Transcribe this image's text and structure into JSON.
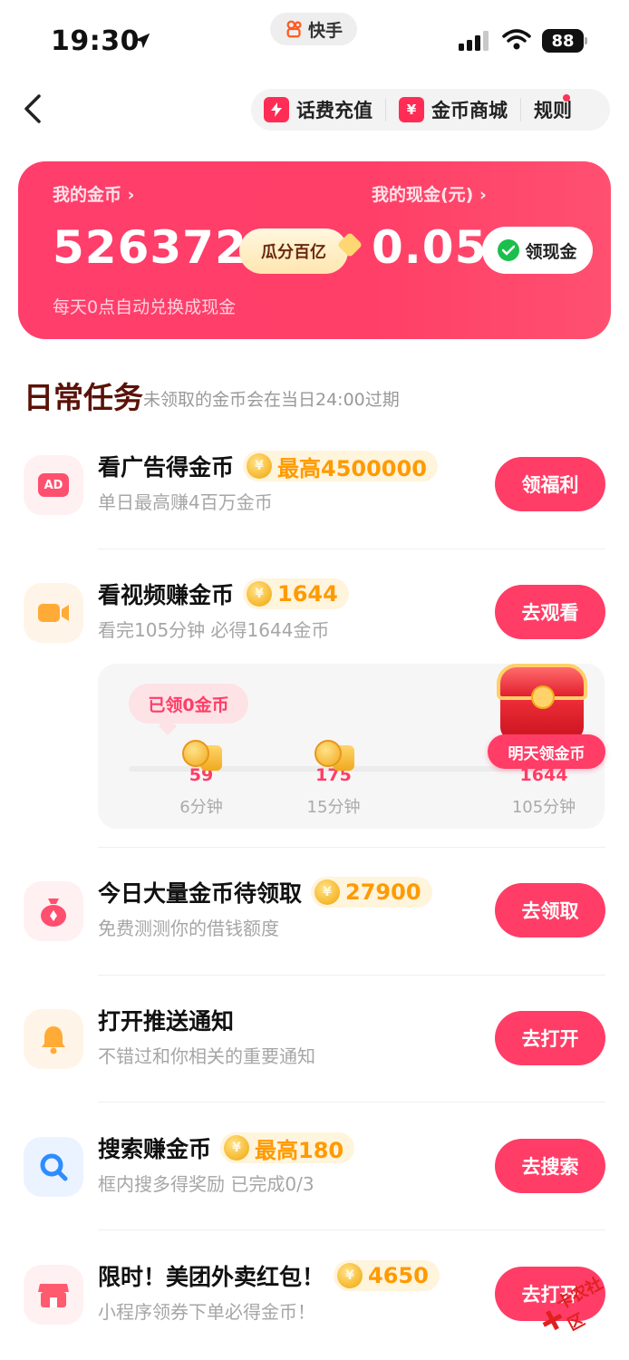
{
  "status_bar": {
    "time": "19:30",
    "app_pill": "快手",
    "battery": "88"
  },
  "top_nav": {
    "recharge_label": "话费充值",
    "mall_label": "金币商城",
    "rules_label": "规则"
  },
  "header_card": {
    "coins_label": "我的金币 ›",
    "coins_value": "526372",
    "share_badge": "瓜分百亿",
    "cash_label": "我的现金(元) ›",
    "cash_value": "0.05",
    "get_cash_button": "领现金",
    "note": "每天0点自动兑换成现金"
  },
  "daily_tasks": {
    "title": "日常任务",
    "subtitle": "未领取的金币会在当日24:00过期",
    "items": [
      {
        "title": "看广告得金币",
        "reward": "最高4500000",
        "desc": "单日最高赚4百万金币",
        "button": "领福利",
        "icon": "ad-icon"
      },
      {
        "title": "看视频赚金币",
        "reward": "1644",
        "desc": "看完105分钟 必得1644金币",
        "button": "去观看",
        "icon": "video-icon"
      },
      {
        "title": "今日大量金币待领取",
        "reward": "27900",
        "desc": "免费测测你的借钱额度",
        "button": "去领取",
        "icon": "money-bag-icon"
      },
      {
        "title": "打开推送通知",
        "reward": "",
        "desc": "不错过和你相关的重要通知",
        "button": "去打开",
        "icon": "bell-icon"
      },
      {
        "title": "搜索赚金币",
        "reward": "最高180",
        "desc": "框内搜多得奖励 已完成0/3",
        "button": "去搜索",
        "icon": "search-icon"
      },
      {
        "title": "限时！美团外卖红包！",
        "reward": "4650",
        "desc": "小程序领券下单必得金币！",
        "button": "去打开",
        "icon": "store-icon"
      }
    ]
  },
  "video_progress": {
    "collected": "已领0金币",
    "milestones": [
      {
        "value": "59",
        "time": "6分钟"
      },
      {
        "value": "175",
        "time": "15分钟"
      },
      {
        "value": "1644",
        "time": "105分钟"
      }
    ],
    "chest_label": "明天领金币"
  },
  "watermark": "卡农社区",
  "colors": {
    "accent": "#ff3d66",
    "reward": "#ff9a00",
    "title_dark": "#5a1208"
  }
}
